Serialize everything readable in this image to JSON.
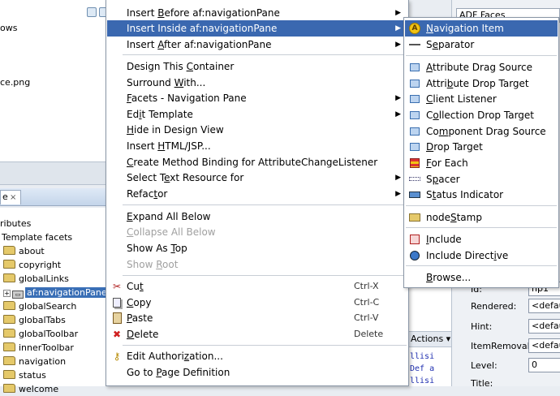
{
  "left_panel": {
    "top_fragments": [
      "ows",
      "ce.png"
    ],
    "structure_tab": "e",
    "tree": [
      {
        "label": "ributes",
        "kind": "text"
      },
      {
        "label": "Template facets",
        "kind": "text"
      },
      {
        "label": "about",
        "kind": "folder"
      },
      {
        "label": "copyright",
        "kind": "folder"
      },
      {
        "label": "globalLinks",
        "kind": "folder"
      },
      {
        "label": "af:navigationPane",
        "kind": "node",
        "selected": true
      },
      {
        "label": "globalSearch",
        "kind": "folder"
      },
      {
        "label": "globalTabs",
        "kind": "folder"
      },
      {
        "label": "globalToolbar",
        "kind": "folder"
      },
      {
        "label": "innerToolbar",
        "kind": "folder"
      },
      {
        "label": "navigation",
        "kind": "folder"
      },
      {
        "label": "status",
        "kind": "folder"
      },
      {
        "label": "welcome",
        "kind": "folder"
      }
    ]
  },
  "middle_panel": {
    "actions_label": "Actions",
    "code_lines": [
      "llisi",
      "Def a",
      "llisi"
    ]
  },
  "property_inspector": {
    "header": "ADF Faces",
    "rows": [
      {
        "label": "Id:",
        "value": "np1"
      },
      {
        "label": "Rendered:",
        "value": "<default>"
      },
      {
        "label": "Hint:",
        "value": "<default>"
      },
      {
        "label": "ItemRemoval:",
        "value": "<default>"
      },
      {
        "label": "Level:",
        "value": "0"
      },
      {
        "label": "Title:",
        "value": ""
      }
    ]
  },
  "main_menu": {
    "items": [
      {
        "pre": "Insert ",
        "ul": "B",
        "post": "efore af:navigationPane",
        "arrow": true
      },
      {
        "pre": "Insert Inside af:navigationPane",
        "ul": "",
        "post": "",
        "arrow": true,
        "highlighted": true
      },
      {
        "pre": "Insert ",
        "ul": "A",
        "post": "fter af:navigationPane",
        "arrow": true
      },
      {
        "pre": "Design This ",
        "ul": "C",
        "post": "ontainer"
      },
      {
        "pre": "Surround ",
        "ul": "W",
        "post": "ith..."
      },
      {
        "pre": "",
        "ul": "F",
        "post": "acets - Navigation Pane",
        "arrow": true
      },
      {
        "pre": "Ed",
        "ul": "i",
        "post": "t Template",
        "arrow": true
      },
      {
        "pre": "",
        "ul": "H",
        "post": "ide in Design View"
      },
      {
        "pre": "Insert ",
        "ul": "H",
        "post": "TML/JSP..."
      },
      {
        "pre": "",
        "ul": "C",
        "post": "reate Method Binding for AttributeChangeListener"
      },
      {
        "pre": "Select T",
        "ul": "e",
        "post": "xt Resource for",
        "arrow": true
      },
      {
        "pre": "Refac",
        "ul": "t",
        "post": "or",
        "arrow": true
      },
      {
        "pre": "",
        "ul": "E",
        "post": "xpand All Below"
      },
      {
        "pre": "",
        "ul": "C",
        "post": "ollapse All Below",
        "disabled": true
      },
      {
        "pre": "Show As ",
        "ul": "T",
        "post": "op"
      },
      {
        "pre": "Show ",
        "ul": "R",
        "post": "oot",
        "disabled": true
      },
      {
        "pre": "Cu",
        "ul": "t",
        "post": "",
        "shortcut": "Ctrl-X",
        "icon": "scissors-icon"
      },
      {
        "pre": "",
        "ul": "C",
        "post": "opy",
        "shortcut": "Ctrl-C",
        "icon": "copy-icon"
      },
      {
        "pre": "",
        "ul": "P",
        "post": "aste",
        "shortcut": "Ctrl-V",
        "icon": "paste-icon"
      },
      {
        "pre": "",
        "ul": "D",
        "post": "elete",
        "shortcut": "Delete",
        "icon": "delete-icon"
      },
      {
        "pre": "Edit Authori",
        "ul": "z",
        "post": "ation...",
        "icon": "key-icon"
      },
      {
        "pre": "Go to ",
        "ul": "P",
        "post": "age Definition"
      }
    ]
  },
  "sub_menu": {
    "items": [
      {
        "pre": "",
        "ul": "N",
        "post": "avigation Item",
        "highlighted": true,
        "icon": "navigation-item-icon"
      },
      {
        "pre": "S",
        "ul": "e",
        "post": "parator",
        "icon": "separator-icon"
      },
      {
        "pre": "",
        "ul": "A",
        "post": "ttribute Drag Source",
        "icon": "attribute-drag-source-icon"
      },
      {
        "pre": "Attri",
        "ul": "b",
        "post": "ute Drop Target",
        "icon": "attribute-drop-target-icon"
      },
      {
        "pre": "",
        "ul": "C",
        "post": "lient Listener",
        "icon": "client-listener-icon"
      },
      {
        "pre": "C",
        "ul": "o",
        "post": "llection Drop Target",
        "icon": "collection-drop-target-icon"
      },
      {
        "pre": "Co",
        "ul": "m",
        "post": "ponent Drag Source",
        "icon": "component-drag-source-icon"
      },
      {
        "pre": "",
        "ul": "D",
        "post": "rop Target",
        "icon": "drop-target-icon"
      },
      {
        "pre": "",
        "ul": "F",
        "post": "or Each",
        "icon": "for-each-icon"
      },
      {
        "pre": "S",
        "ul": "p",
        "post": "acer",
        "icon": "spacer-icon"
      },
      {
        "pre": "S",
        "ul": "t",
        "post": "atus Indicator",
        "icon": "status-indicator-icon"
      },
      {
        "pre": "node",
        "ul": "S",
        "post": "tamp",
        "icon": "nodestamp-icon"
      },
      {
        "pre": "",
        "ul": "I",
        "post": "nclude",
        "icon": "include-icon"
      },
      {
        "pre": "Include Direct",
        "ul": "i",
        "post": "ve",
        "icon": "include-directive-icon"
      },
      {
        "pre": "",
        "ul": "B",
        "post": "rowse...",
        "icon": ""
      }
    ]
  }
}
